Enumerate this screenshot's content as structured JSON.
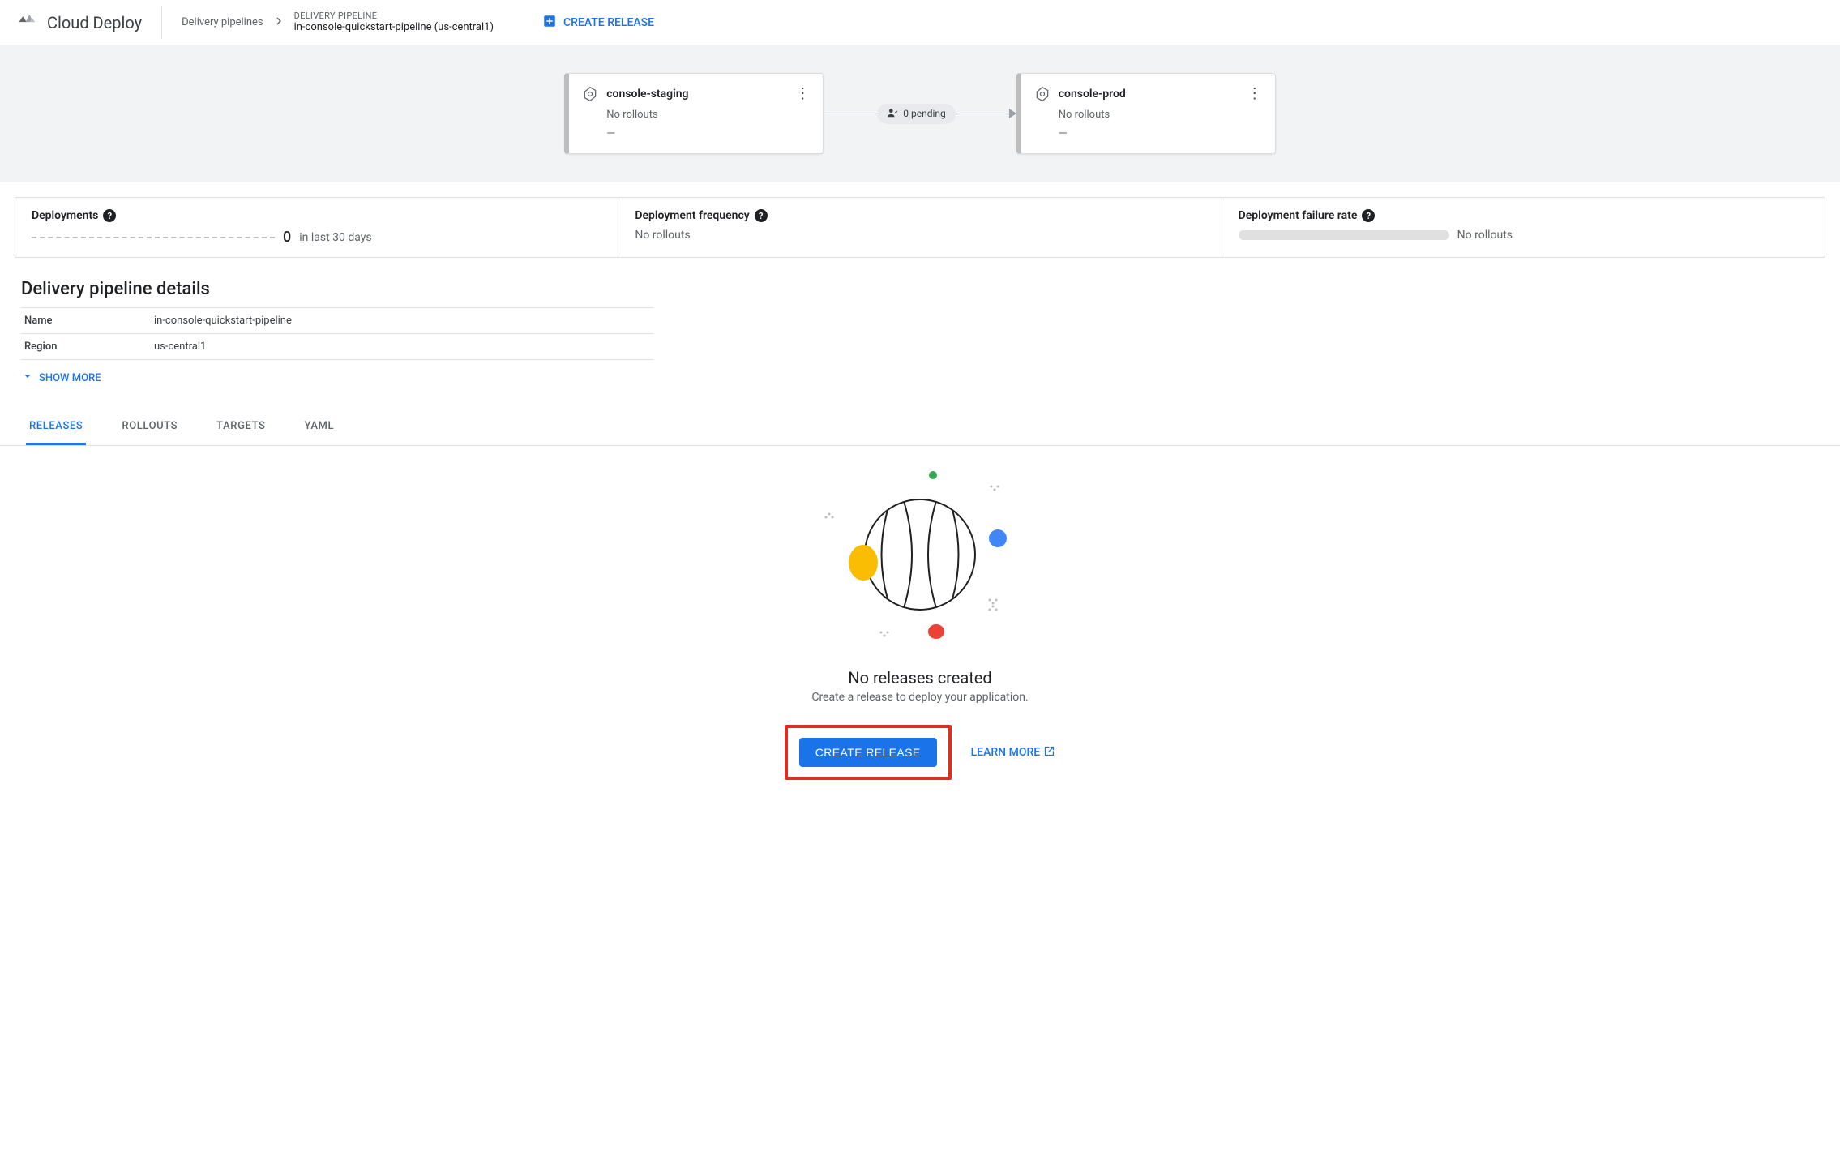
{
  "header": {
    "product_name": "Cloud Deploy",
    "breadcrumb_parent": "Delivery pipelines",
    "breadcrumb_label": "DELIVERY PIPELINE",
    "breadcrumb_value": "in-console-quickstart-pipeline (us-central1)",
    "create_release_label": "CREATE RELEASE"
  },
  "stages": {
    "staging": {
      "name": "console-staging",
      "status": "No rollouts",
      "dash": "—"
    },
    "prod": {
      "name": "console-prod",
      "status": "No rollouts",
      "dash": "—"
    },
    "pending_label": "0 pending"
  },
  "metrics": {
    "deployments_label": "Deployments",
    "deployments_count": "0",
    "deployments_period": "in last 30 days",
    "frequency_label": "Deployment frequency",
    "frequency_value": "No rollouts",
    "failure_label": "Deployment failure rate",
    "failure_value": "No rollouts"
  },
  "details": {
    "title": "Delivery pipeline details",
    "name_label": "Name",
    "name_value": "in-console-quickstart-pipeline",
    "region_label": "Region",
    "region_value": "us-central1",
    "show_more": "SHOW MORE"
  },
  "tabs": {
    "releases": "RELEASES",
    "rollouts": "ROLLOUTS",
    "targets": "TARGETS",
    "yaml": "YAML"
  },
  "empty": {
    "title": "No releases created",
    "subtitle": "Create a release to deploy your application.",
    "create_button": "CREATE RELEASE",
    "learn_more": "LEARN MORE"
  }
}
